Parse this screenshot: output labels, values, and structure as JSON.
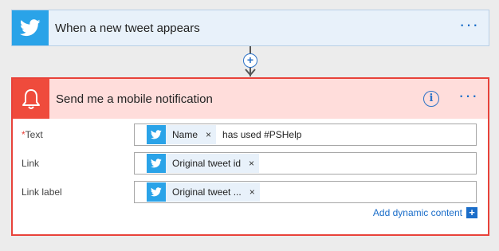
{
  "trigger": {
    "title": "When a new tweet appears",
    "icon": "twitter-bird-icon",
    "menu_label": "···",
    "color": "#2aa3e8"
  },
  "connector": {
    "add_label": "+"
  },
  "action": {
    "title": "Send me a mobile notification",
    "icon": "bell-icon",
    "info_label": "i",
    "menu_label": "···",
    "accent_color": "#e8423a",
    "fields": {
      "text": {
        "required_mark": "*",
        "label": "Text",
        "token": "Name",
        "token_remove": "×",
        "literal": "has used #PSHelp"
      },
      "link": {
        "label": "Link",
        "token": "Original tweet id",
        "token_remove": "×"
      },
      "link_label": {
        "label": "Link label",
        "token": "Original tweet ...",
        "token_remove": "×"
      }
    },
    "add_dynamic_label": "Add dynamic content",
    "add_dynamic_plus": "+"
  }
}
